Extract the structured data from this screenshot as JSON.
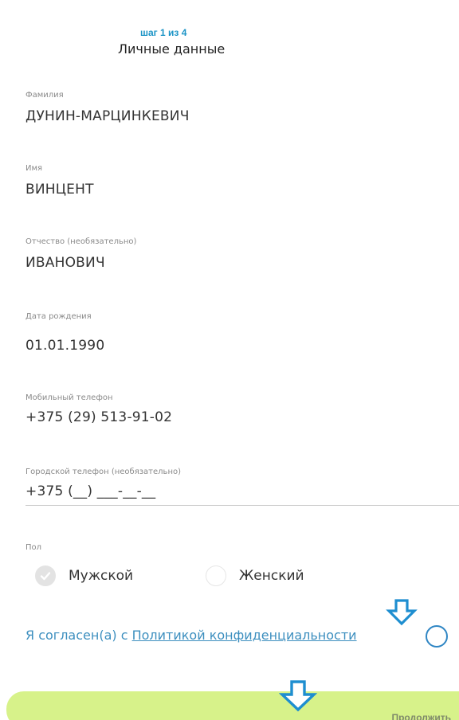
{
  "header": {
    "step": "шаг 1 из 4",
    "title": "Личные данные"
  },
  "form": {
    "last_name": {
      "label": "Фамилия",
      "value": "ДУНИН-МАРЦИНКЕВИЧ"
    },
    "first_name": {
      "label": "Имя",
      "value": "ВИНЦЕНТ"
    },
    "patronymic": {
      "label": "Отчество (необязательно)",
      "value": "ИВАНОВИЧ"
    },
    "birth_date": {
      "label": "Дата рождения",
      "value": "01.01.1990"
    },
    "mobile_phone": {
      "label": "Мобильный телефон",
      "value": "+375 (29) 513-91-02"
    },
    "home_phone": {
      "label": "Городской телефон (необязательно)",
      "value": "+375 (__) ___-__-__"
    },
    "gender": {
      "label": "Пол",
      "options": [
        {
          "label": "Мужской",
          "selected": true
        },
        {
          "label": "Женский",
          "selected": false
        }
      ]
    },
    "consent": {
      "prefix": "Я согласен(а) с ",
      "link": "Политикой конфиденциальности",
      "checked": false
    }
  },
  "actions": {
    "continue_label": "Продолжить"
  },
  "colors": {
    "accent": "#1b94c6",
    "link": "#3d8fbf",
    "button": "#d7f28a",
    "arrow": "#1e8ed0"
  },
  "icons": {
    "gender_selected": "check-icon",
    "annotation": "arrow-down-icon"
  }
}
